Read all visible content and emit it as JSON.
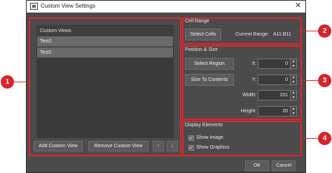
{
  "window": {
    "title": "Custom View Settings",
    "close_glyph": "✕"
  },
  "list": {
    "header": "Custom Views",
    "items": [
      {
        "label": "Test1"
      },
      {
        "label": "Test2"
      }
    ]
  },
  "list_buttons": {
    "add": "Add Custom View",
    "remove": "Remove Custom View",
    "up": "↑",
    "down": "↓"
  },
  "cell_range": {
    "title": "Cell Range",
    "select_button": "Select Cells",
    "current_range_label": "Current Range:",
    "current_range_value": "A11:B11"
  },
  "position_size": {
    "title": "Position & Size",
    "select_region_button": "Select Region",
    "size_to_contents_button": "Size To Contents",
    "x_label": "X:",
    "x_value": "0",
    "y_label": "Y:",
    "y_value": "0",
    "width_label": "Width:",
    "width_value": "151",
    "height_label": "Height:",
    "height_value": "20"
  },
  "display_elements": {
    "title": "Display Elements",
    "show_image_label": "Show Image",
    "show_image_checked": true,
    "show_graphics_label": "Show Graphics",
    "show_graphics_checked": true
  },
  "footer": {
    "ok": "OK",
    "cancel": "Cancel"
  },
  "callouts": [
    "1",
    "2",
    "3",
    "4"
  ],
  "colors": {
    "accent_red": "#e0262d",
    "window_bg": "#4b4b4b"
  }
}
